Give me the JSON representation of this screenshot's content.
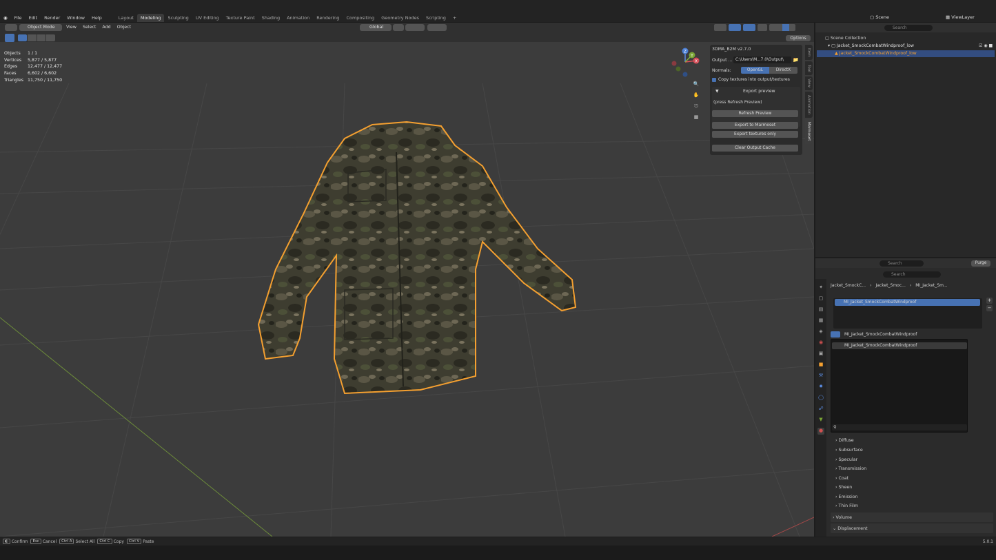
{
  "menubar": {
    "items": [
      "File",
      "Edit",
      "Render",
      "Window",
      "Help"
    ],
    "workspaces": [
      "Layout",
      "Modeling",
      "Sculpting",
      "UV Editing",
      "Texture Paint",
      "Shading",
      "Animation",
      "Rendering",
      "Compositing",
      "Geometry Nodes",
      "Scripting"
    ],
    "active_workspace": "Modeling",
    "add_tab": "+",
    "scene_label": "Scene",
    "viewlayer_label": "ViewLayer"
  },
  "viewport_header": {
    "mode": "Object Mode",
    "menus": [
      "View",
      "Select",
      "Add",
      "Object"
    ],
    "transform": "Global",
    "options": "Options"
  },
  "stats": [
    {
      "label": "Objects",
      "value": "1 / 1"
    },
    {
      "label": "Vertices",
      "value": "5,877 / 5,877"
    },
    {
      "label": "Edges",
      "value": "12,477 / 12,477"
    },
    {
      "label": "Faces",
      "value": "6,602 / 6,602"
    },
    {
      "label": "Triangles",
      "value": "11,750 / 11,750"
    }
  ],
  "gizmo": {
    "z": "Z",
    "y": "Y",
    "x": "X"
  },
  "npanel": {
    "title": "3DMA_B2M  v2.7.0",
    "output_label": "Output ...",
    "output_value": "C:\\Users\\M...7.0\\Output\\",
    "normals_label": "Normals:",
    "normals_options": [
      "OpenGL",
      "DirectX"
    ],
    "copy_textures": "Copy textures into output/textures",
    "export_preview": "Export preview",
    "press_refresh": "(press Refresh Preview)",
    "refresh_preview": "Refresh Preview",
    "export_marmoset": "Export to Marmoset",
    "export_textures": "Export textures only",
    "clear_cache": "Clear Output Cache"
  },
  "tabs": [
    "Item",
    "Tool",
    "View",
    "Animation",
    "Marmoset"
  ],
  "active_tab": "Marmoset",
  "outliner": {
    "search_placeholder": "Search",
    "scene_collection": "Scene Collection",
    "collection": "Jacket_SmockCombatWindproof_low",
    "object": "Jacket_SmockCombatWindproof_low"
  },
  "properties": {
    "search_placeholder": "Search",
    "purge": "Purge",
    "breadcrumb": [
      "Jacket_SmockC...",
      "Jacket_Smoc...",
      "MI_Jacket_Sm..."
    ],
    "slot": "MI_Jacket_SmockCombatWindproof",
    "material_name": "MI_Jacket_SmockCombatWindproof",
    "dropdown_item": "MI_Jacket_SmockCombatWindproof",
    "sections": [
      "Diffuse",
      "Subsurface",
      "Specular",
      "Transmission",
      "Coat",
      "Sheen",
      "Emission",
      "Thin Film"
    ],
    "top_sections": [
      "Volume",
      "Displacement"
    ]
  },
  "statusbar": {
    "items": [
      {
        "key": "",
        "label": "Confirm"
      },
      {
        "key": "Esc",
        "label": "Cancel"
      },
      {
        "key": "Ctrl A",
        "label": "Select All"
      },
      {
        "key": "Ctrl C",
        "label": "Copy"
      },
      {
        "key": "Ctrl V",
        "label": "Paste"
      }
    ],
    "version": "5.0.1"
  },
  "colors": {
    "accent": "#4772b3",
    "selection_outline": "#f5a030",
    "viewport_bg": "#3c3c3c"
  }
}
